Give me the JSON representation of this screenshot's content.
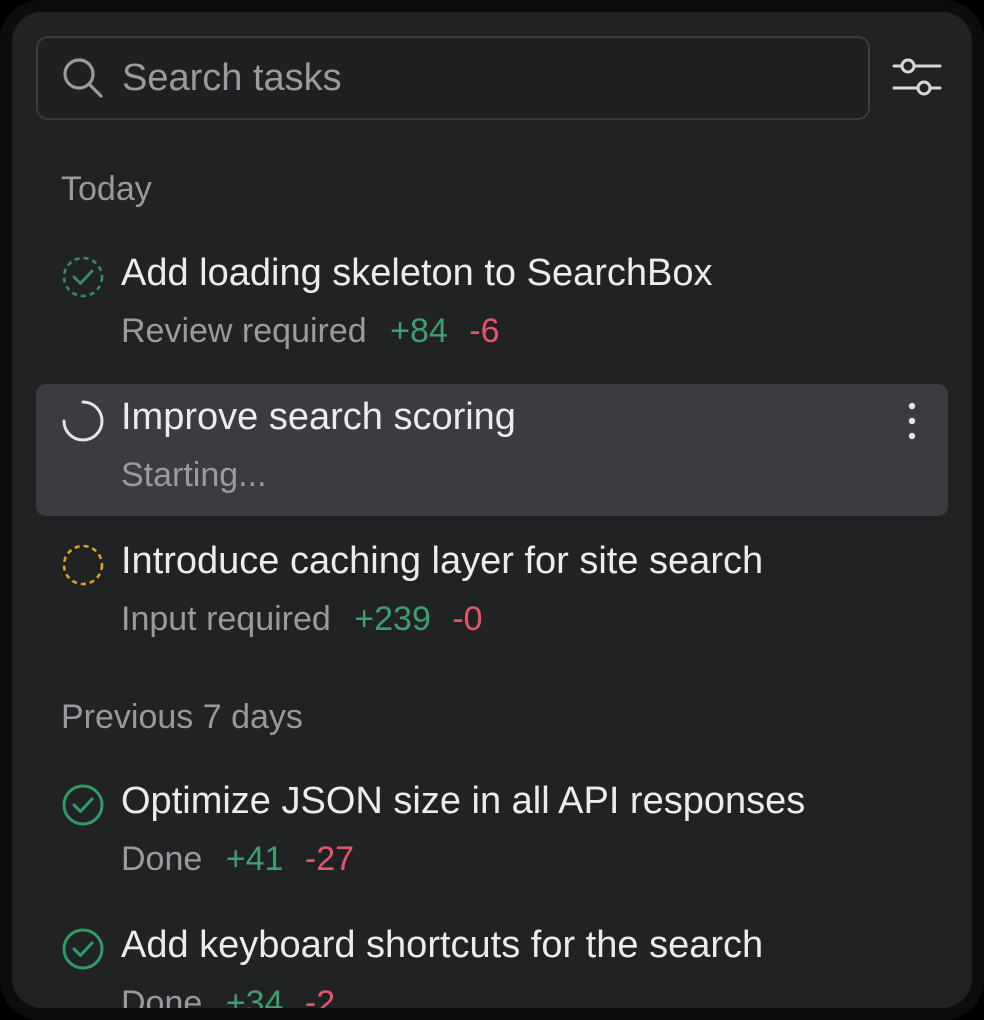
{
  "search": {
    "placeholder": "Search tasks"
  },
  "icons": {
    "search": "search-icon",
    "filter": "sliders-icon",
    "more": "more-vertical-icon"
  },
  "colors": {
    "added": "#3f9e6f",
    "removed": "#e5566a",
    "review_pending": "#2f8e63",
    "input_required": "#e3a020",
    "done": "#2f9b67"
  },
  "sections": [
    {
      "header": "Today",
      "tasks": [
        {
          "title": "Add loading skeleton to SearchBox",
          "status": "Review required",
          "added": "+84",
          "removed": "-6",
          "icon": "dashed-check-circle-icon"
        },
        {
          "title": "Improve search scoring",
          "status": "Starting...",
          "added": "",
          "removed": "",
          "icon": "spinner-icon"
        },
        {
          "title": "Introduce caching layer for site search",
          "status": "Input required",
          "added": "+239",
          "removed": "-0",
          "icon": "dashed-circle-icon"
        }
      ]
    },
    {
      "header": "Previous 7 days",
      "tasks": [
        {
          "title": "Optimize JSON size in all API responses",
          "status": "Done",
          "added": "+41",
          "removed": "-27",
          "icon": "check-circle-icon"
        },
        {
          "title": "Add keyboard shortcuts for the search",
          "status": "Done",
          "added": "+34",
          "removed": "-2",
          "icon": "check-circle-icon"
        }
      ]
    }
  ]
}
